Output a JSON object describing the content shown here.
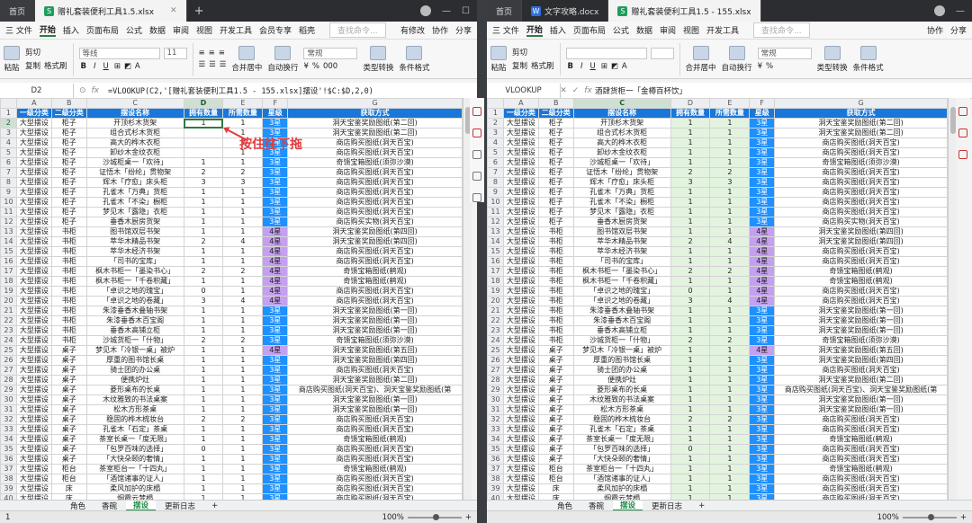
{
  "left": {
    "home_tab": "首页",
    "file_tab": "赠礼套装便利工具1.5.xlsx",
    "name_box": "D2",
    "formula": "=VLOOKUP(C2,'[赠礼套装便利工具1.5 - 155.xlsx]摆设'!$C:$D,2,0)",
    "annotation": "按住往下拖",
    "sheet_tabs": [
      "角色",
      "香碗",
      "摆设",
      "更新日志"
    ],
    "active_sheet": "摆设",
    "status_page": "1",
    "zoom": "100%"
  },
  "right": {
    "home_tab": "首页",
    "file_tab": "文字攻略.docx",
    "file_tab2": "赠礼套装便利工具1.5 - 155.xlsx",
    "name_box": "VLOOKUP",
    "formula": "酒肆货柜一「金樽百杯饮」",
    "sheet_tabs": [
      "角色",
      "香碗",
      "摆设",
      "更新日志"
    ],
    "active_sheet": "摆设",
    "zoom": "100%"
  },
  "menu": {
    "items": [
      "三 文件",
      "开始",
      "插入",
      "页面布局",
      "公式",
      "数据",
      "审阅",
      "视图",
      "开发工具",
      "会员专享",
      "稻壳"
    ],
    "search": "查找命令...",
    "right_items": [
      "有修改",
      "协作",
      "分享"
    ]
  },
  "ribbon": {
    "cut": "剪切",
    "copy": "复制",
    "format_painter": "格式刷",
    "paste": "粘贴",
    "font": "等线",
    "size": "11",
    "number_format": "常规",
    "merge": "合并居中",
    "wrap": "自动换行",
    "type_convert": "类型转换",
    "cond": "条件格式"
  },
  "columns": [
    "A",
    "B",
    "C",
    "D",
    "E",
    "F",
    "G"
  ],
  "headers": [
    "一级分类",
    "二级分类",
    "摆设名称",
    "拥有数量",
    "所需数量",
    "星级",
    "获取方式"
  ],
  "rows": [
    [
      "大型摆设",
      "柜子",
      "开顶杉木货架",
      "1",
      "1",
      "3星",
      "洞天宝鉴奖励图纸(第二回)"
    ],
    [
      "大型摆设",
      "柜子",
      "组合式杉木货柜",
      "1",
      "1",
      "3星",
      "洞天宝鉴奖励图纸(第二回)"
    ],
    [
      "大型摆设",
      "柜子",
      "高大的桦木衣柜",
      "1",
      "1",
      "3星",
      "商店购买图纸(洞天百宝)"
    ],
    [
      "大型摆设",
      "柜子",
      "卸纱木金纹衣柜",
      "1",
      "1",
      "3星",
      "商店购买图纸(洞天百宝)"
    ],
    [
      "大型摆设",
      "柜子",
      "沙城柜桌一「欢待」",
      "1",
      "1",
      "3星",
      "奇馈宝箱图纸(须弥沙漠)"
    ],
    [
      "大型摆设",
      "柜子",
      "证悟木「纷纶」贯物架",
      "2",
      "2",
      "3星",
      "商店购买图纸(洞天百宝)"
    ],
    [
      "大型摆设",
      "柜子",
      "辉木「疗愈」床头柜",
      "3",
      "3",
      "3星",
      "商店购买图纸(洞天百宝)"
    ],
    [
      "大型摆设",
      "柜子",
      "孔雀木「万典」货柜",
      "1",
      "1",
      "3星",
      "商店购买图纸(洞天百宝)"
    ],
    [
      "大型摆设",
      "柜子",
      "孔雀木「不染」橱柜",
      "1",
      "1",
      "3星",
      "商店购买图纸(洞天百宝)"
    ],
    [
      "大型摆设",
      "柜子",
      "梦见木「露隐」衣柜",
      "1",
      "1",
      "3星",
      "商店购买图纸(洞天百宝)"
    ],
    [
      "大型摆设",
      "柜子",
      "垂香木厨房货架",
      "1",
      "1",
      "3星",
      "商店购买实物(洞天百宝)"
    ],
    [
      "大型摆设",
      "书柜",
      "图书馆双层书架",
      "1",
      "1",
      "4星",
      "洞天宝鉴奖励图纸(第四回)"
    ],
    [
      "大型摆设",
      "书柜",
      "萃华木精品书架",
      "2",
      "4",
      "4星",
      "洞天宝鉴奖励图纸(第四回)"
    ],
    [
      "大型摆设",
      "书柜",
      "萃华木经济书架",
      "1",
      "1",
      "4星",
      "商店购买图纸(洞天百宝)"
    ],
    [
      "大型摆设",
      "书柜",
      "「司书的宝库」",
      "1",
      "1",
      "4星",
      "商店购买图纸(洞天百宝)"
    ],
    [
      "大型摆设",
      "书柜",
      "枫木书柜一「墨染书心」",
      "2",
      "2",
      "4星",
      "奇馈宝箱图纸(鹤观)"
    ],
    [
      "大型摆设",
      "书柜",
      "枫木书柜一「千卷积藏」",
      "1",
      "1",
      "4星",
      "奇馈宝箱图纸(鹤观)"
    ],
    [
      "大型摆设",
      "书柜",
      "「卓识之地的瑰宝」",
      "0",
      "1",
      "4星",
      "商店购买图纸(洞天百宝)"
    ],
    [
      "大型摆设",
      "书柜",
      "「卓识之地的卷藏」",
      "3",
      "4",
      "4星",
      "商店购买图纸(洞天百宝)"
    ],
    [
      "大型摆设",
      "书柜",
      "朱漆垂香木叠轴书架",
      "1",
      "1",
      "3星",
      "洞天宝鉴奖励图纸(第一回)"
    ],
    [
      "大型摆设",
      "书柜",
      "朱漆垂香木百宝阁",
      "1",
      "1",
      "3星",
      "洞天宝鉴奖励图纸(第一回)"
    ],
    [
      "大型摆设",
      "书柜",
      "垂香木高铺立柜",
      "1",
      "1",
      "3星",
      "洞天宝鉴奖励图纸(第一回)"
    ],
    [
      "大型摆设",
      "书柜",
      "沙城货柜一「什物」",
      "2",
      "2",
      "3星",
      "奇馈宝箱图纸(须弥沙漠)"
    ],
    [
      "大型摆设",
      "桌子",
      "梦见木「冷银一桌」被炉",
      "1",
      "1",
      "4星",
      "洞天宝鉴奖励图纸(第五回)"
    ],
    [
      "大型摆设",
      "桌子",
      "厚重的图书馆长桌",
      "1",
      "1",
      "3星",
      "洞天宝鉴奖励图纸(第四回)"
    ],
    [
      "大型摆设",
      "桌子",
      "骑士团的办公桌",
      "1",
      "1",
      "3星",
      "商店购买图纸(洞天百宝)"
    ],
    [
      "大型摆设",
      "桌子",
      "便携炉灶",
      "1",
      "1",
      "3星",
      "洞天宝鉴奖励图纸(第二回)"
    ],
    [
      "大型摆设",
      "桌子",
      "菱形桌布的长桌",
      "1",
      "1",
      "3星",
      "商店购买图纸(洞天百宝)、洞天宝鉴奖励图纸(第"
    ],
    [
      "大型摆设",
      "桌子",
      "木纹雅致的书法桌案",
      "1",
      "1",
      "3星",
      "洞天宝鉴奖励图纸(第一回)"
    ],
    [
      "大型摆设",
      "桌子",
      "松木方形茶桌",
      "1",
      "1",
      "3星",
      "洞天宝鉴奖励图纸(第一回)"
    ],
    [
      "大型摆设",
      "桌子",
      "稳固的桦木梳妆台",
      "2",
      "2",
      "3星",
      "商店购买图纸(洞天百宝)"
    ],
    [
      "大型摆设",
      "桌子",
      "孔雀木「石定」茶桌",
      "1",
      "1",
      "3星",
      "商店购买图纸(洞天百宝)"
    ],
    [
      "大型摆设",
      "桌子",
      "茶室长桌一「度无限」",
      "1",
      "1",
      "3星",
      "奇馈宝箱图纸(鹤观)"
    ],
    [
      "大型摆设",
      "桌子",
      "「包罗百味的选择」",
      "0",
      "1",
      "3星",
      "商店购买图纸(洞天百宝)"
    ],
    [
      "大型摆设",
      "桌子",
      "「大快朵颐的奢情」",
      "1",
      "1",
      "3星",
      "商店购买图纸(洞天百宝)"
    ],
    [
      "大型摆设",
      "柜台",
      "茶室柜台一「十四丸」",
      "1",
      "1",
      "3星",
      "奇馈宝箱图纸(鹤观)"
    ],
    [
      "大型摆设",
      "柜台",
      "「酒馆诸事的证人」",
      "1",
      "1",
      "3星",
      "商店购买图纸(洞天百宝)"
    ],
    [
      "大型摆设",
      "床",
      "柔风加护的床榻",
      "1",
      "1",
      "3星",
      "商店购买图纸(洞天百宝)"
    ],
    [
      "大型摆设",
      "床",
      "烟霞云梦榻",
      "1",
      "1",
      "3星",
      "商店购买图纸(洞天百宝)"
    ],
    [
      "大型摆设",
      "床",
      "梦见木「椰眠」床榻",
      "1",
      "1",
      "3星",
      "商店购买图纸(洞天百宝)"
    ]
  ]
}
